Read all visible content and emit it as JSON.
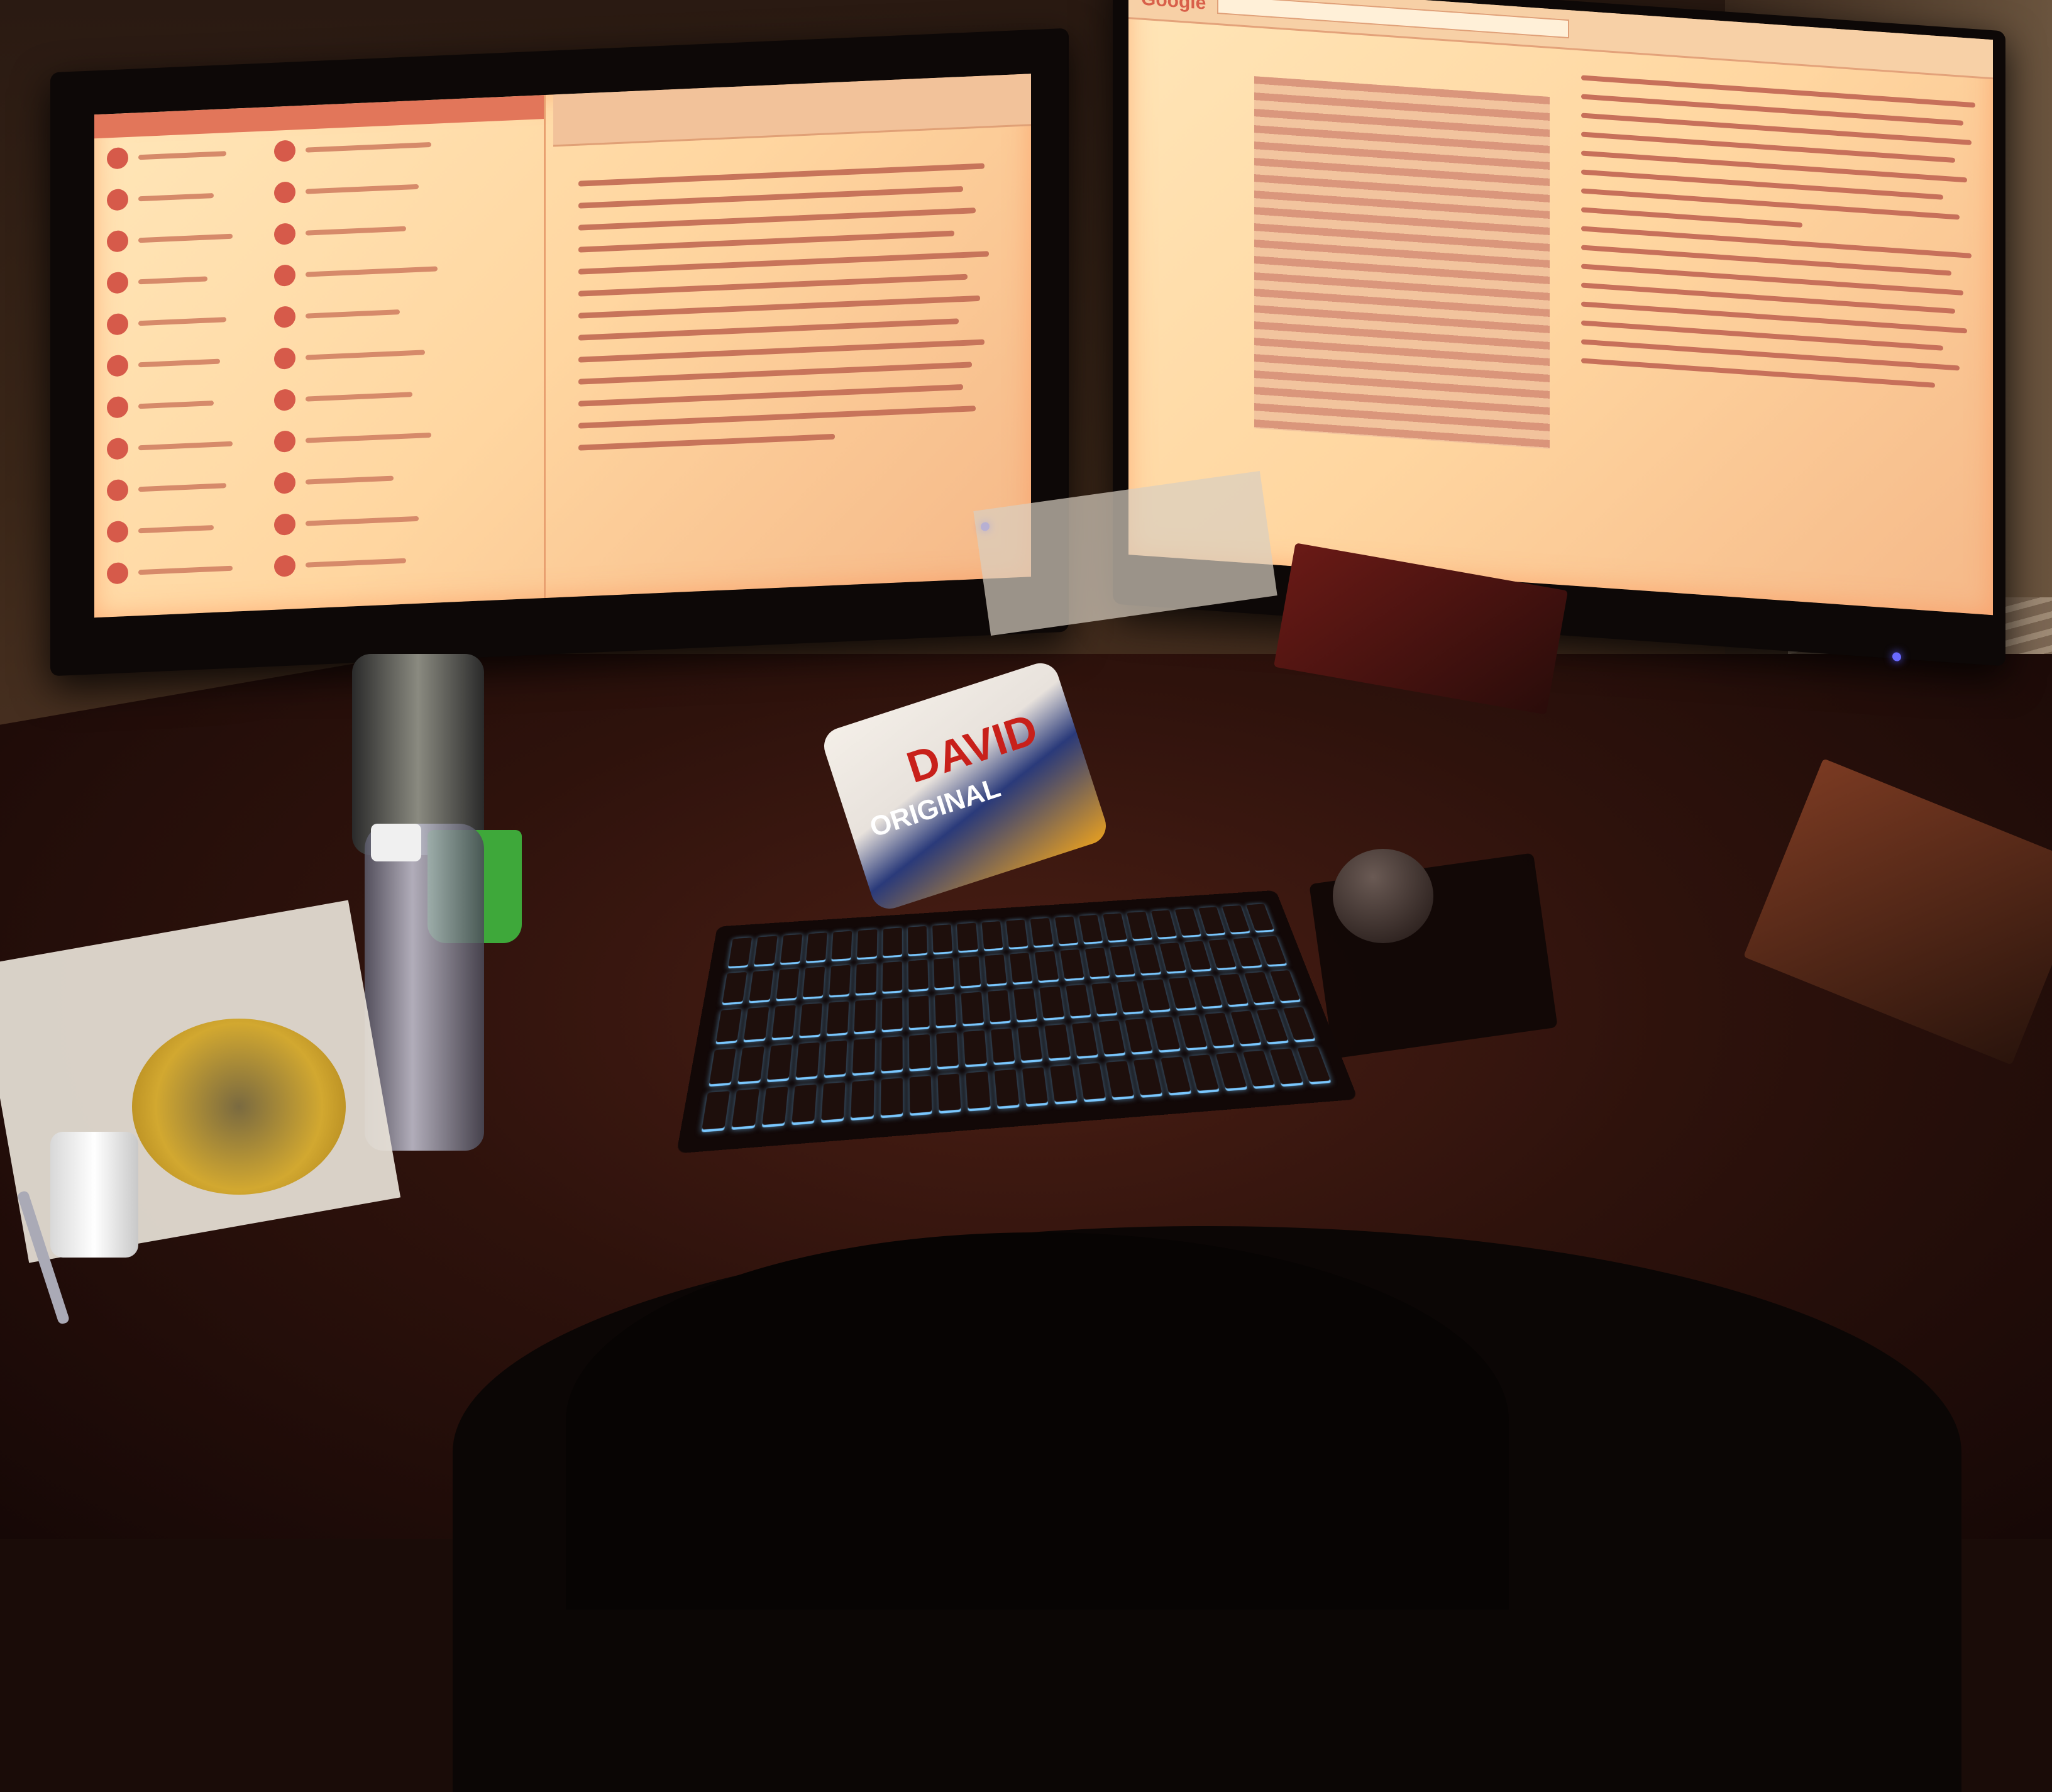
{
  "scene": {
    "left_monitor": {
      "left_app": {
        "title": ""
      },
      "doc_app": {
        "title": ""
      }
    },
    "right_monitor": {
      "browser": {
        "logo": "Google",
        "search_text": ""
      }
    },
    "chips_bag": {
      "brand": "DAVID",
      "variant": "ORIGINAL"
    }
  }
}
